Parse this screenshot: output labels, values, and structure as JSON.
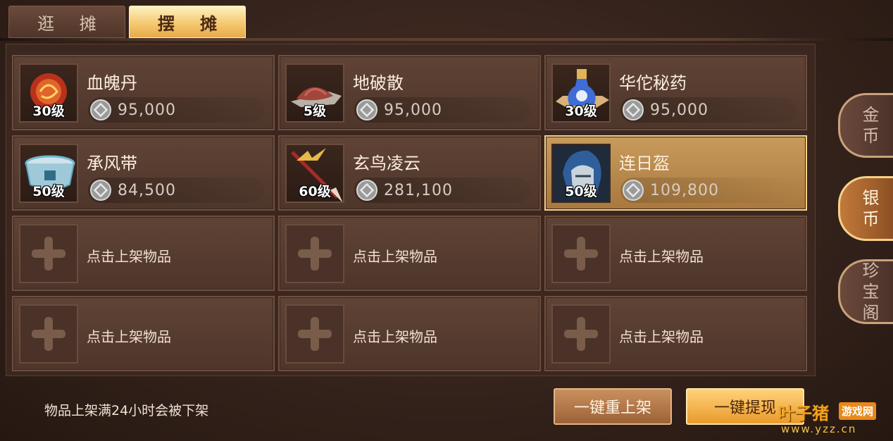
{
  "tabs": [
    {
      "label": "逛 摊",
      "active": false
    },
    {
      "label": "摆 摊",
      "active": true
    }
  ],
  "side_tabs": [
    {
      "label": "金\n币",
      "lines": [
        "金",
        "币"
      ],
      "active": false
    },
    {
      "label": "银\n币",
      "lines": [
        "银",
        "币"
      ],
      "active": true
    },
    {
      "label": "珍\n宝\n阁",
      "lines": [
        "珍",
        "宝",
        "阁"
      ],
      "active": false
    }
  ],
  "items": [
    {
      "name": "血魄丹",
      "level": "30级",
      "price": "95,000",
      "icon": "red-orb-icon"
    },
    {
      "name": "地破散",
      "level": "5级",
      "price": "95,000",
      "icon": "red-powder-icon"
    },
    {
      "name": "华佗秘药",
      "level": "30级",
      "price": "95,000",
      "icon": "potion-bottle-icon"
    },
    {
      "name": "承风带",
      "level": "50级",
      "price": "84,500",
      "icon": "belt-icon"
    },
    {
      "name": "玄鸟凌云",
      "level": "60级",
      "price": "281,100",
      "icon": "spear-icon"
    },
    {
      "name": "连日盔",
      "level": "50级",
      "price": "109,800",
      "icon": "helmet-icon",
      "selected": true
    }
  ],
  "empty_slot_label": "点击上架物品",
  "empty_slots": [
    {
      "label": "点击上架物品"
    },
    {
      "label": "点击上架物品"
    },
    {
      "label": "点击上架物品"
    },
    {
      "label": "点击上架物品"
    },
    {
      "label": "点击上架物品"
    },
    {
      "label": "点击上架物品"
    }
  ],
  "footer": {
    "notice": "物品上架满24小时会被下架",
    "relist_button": "一键重上架",
    "withdraw_button": "一键提现"
  },
  "watermark": {
    "main": "叶子猪",
    "badge": "游戏网",
    "url": "www.yzz.cn"
  },
  "colors": {
    "accent_gold": "#f3c66b",
    "selected_slot": "#c89b5b",
    "panel_bg": "#3b271f"
  }
}
